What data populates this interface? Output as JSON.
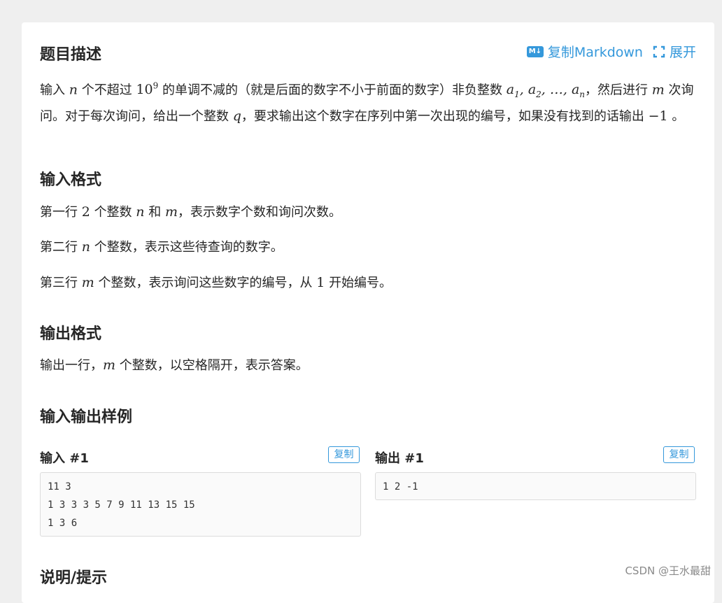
{
  "header": {
    "title": "题目描述",
    "copy_markdown_label": "复制Markdown",
    "expand_label": "展开",
    "md_icon_text": "M↓"
  },
  "description": {
    "p1_a": "输入",
    "p1_n": "n",
    "p1_b": "个不超过",
    "p1_ten": "10",
    "p1_exp": "9",
    "p1_c": "的单调不减的（就是后面的数字不小于前面的数字）非负整数",
    "p1_seq_a1": "a",
    "p1_sub1": "1",
    "p1_seq_a2": "a",
    "p1_sub2": "2",
    "p1_dots": "…",
    "p1_seq_an": "a",
    "p1_subn": "n",
    "p1_d": "，然后进行",
    "p1_m": "m",
    "p1_e": "次询问。对于每次询问，给出一个整数",
    "p1_q": "q",
    "p1_f": "，要求输出这个数字在序列中第一次出现的编号，如果没有找到的话输出",
    "p1_neg1": "−1",
    "p1_g": "。"
  },
  "input_format": {
    "title": "输入格式",
    "l1_a": "第一行",
    "l1_two": "2",
    "l1_b": "个整数",
    "l1_n": "n",
    "l1_c": "和",
    "l1_m": "m",
    "l1_d": "，表示数字个数和询问次数。",
    "l2_a": "第二行",
    "l2_n": "n",
    "l2_b": "个整数，表示这些待查询的数字。",
    "l3_a": "第三行",
    "l3_m": "m",
    "l3_b": "个整数，表示询问这些数字的编号，从",
    "l3_one": "1",
    "l3_c": "开始编号。"
  },
  "output_format": {
    "title": "输出格式",
    "l1_a": "输出一行，",
    "l1_m": "m",
    "l1_b": "个整数，以空格隔开，表示答案。"
  },
  "samples": {
    "title": "输入输出样例",
    "input_label": "输入 #1",
    "output_label": "输出 #1",
    "copy_label": "复制",
    "input_lines": [
      "11 3",
      "1 3 3 3 5 7 9 11 13 15 15",
      "1 3 6"
    ],
    "output_lines": [
      "1 2 -1"
    ]
  },
  "hint": {
    "title": "说明/提示"
  },
  "watermark": "CSDN @王水最甜",
  "colors": {
    "accent": "#3498db",
    "background": "#efefef",
    "card": "#ffffff",
    "code_bg": "#fafafa"
  }
}
